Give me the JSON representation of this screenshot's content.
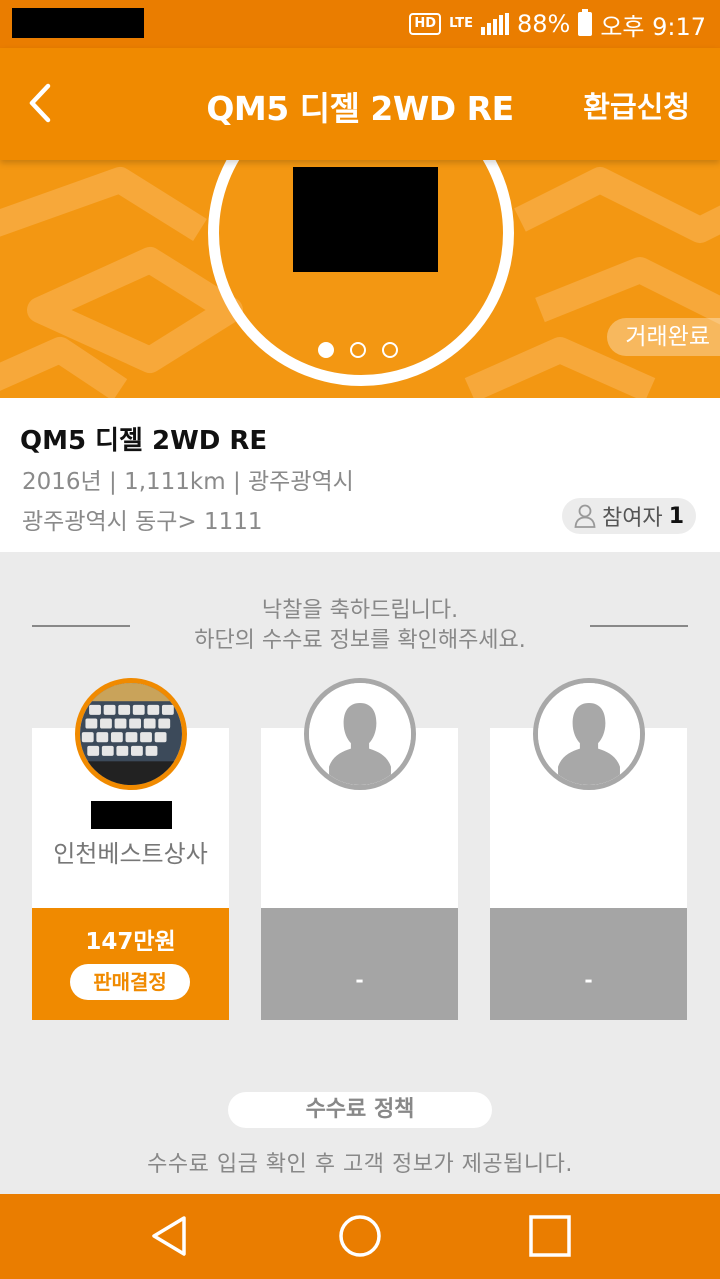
{
  "status_bar": {
    "hd_label": "HD",
    "network_label": "LTE",
    "battery_text": "88%",
    "clock_text": "오후 9:17"
  },
  "header": {
    "title": "QM5 디젤 2WD RE",
    "refund_label": "환급신청",
    "back_icon": "chevron-left-icon"
  },
  "banner": {
    "status_badge": "거래완료",
    "active_slide": 1,
    "slide_count": 3,
    "background_color": "#f39712"
  },
  "vehicle": {
    "title": "QM5 디젤 2WD RE",
    "meta": "2016년 | 1,111km | 광주광역시",
    "location": "광주광역시 동구> 1111",
    "participants_label": "참여자",
    "participants_count": "1"
  },
  "congrats": {
    "line1": "낙찰을 축하드립니다.",
    "line2": "하단의 수수료 정보를 확인해주세요."
  },
  "bids": [
    {
      "company": "인천베스트상사",
      "price": "147만원",
      "action_label": "판매결정",
      "state": "winner"
    },
    {
      "company": "",
      "price": "-",
      "state": "empty"
    },
    {
      "company": "",
      "price": "-",
      "state": "empty"
    }
  ],
  "fee_policy": {
    "title": "수수료 정책",
    "description": "수수료 입금 확인 후 고객 정보가 제공됩니다."
  },
  "nav_bar": {
    "back_icon": "triangle-back-icon",
    "home_icon": "circle-home-icon",
    "recents_icon": "square-recents-icon"
  },
  "colors": {
    "accent": "#f08a00",
    "status_bar": "#ea7d00",
    "empty_card": "#a5a5a5",
    "background": "#ebebeb"
  }
}
